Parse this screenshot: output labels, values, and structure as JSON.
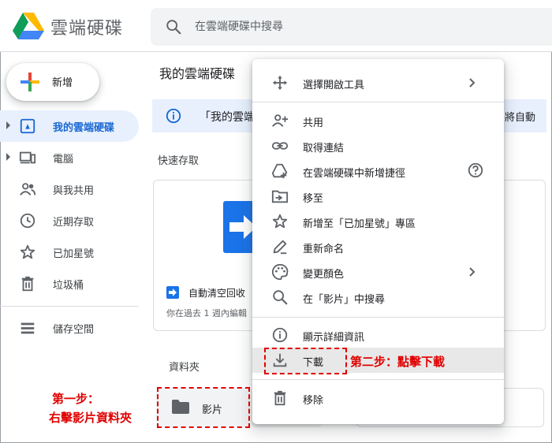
{
  "app": {
    "title": "雲端硬碟",
    "search_placeholder": "在雲端硬碟中搜尋"
  },
  "sidebar": {
    "new_label": "新增",
    "items": [
      {
        "label": "我的雲端硬碟",
        "icon": "my-drive-icon",
        "active": true
      },
      {
        "label": "電腦",
        "icon": "computers-icon"
      },
      {
        "label": "與我共用",
        "icon": "shared-icon"
      },
      {
        "label": "近期存取",
        "icon": "clock-icon"
      },
      {
        "label": "已加星號",
        "icon": "star-icon"
      },
      {
        "label": "垃圾桶",
        "icon": "trash-icon"
      }
    ],
    "storage_label": "儲存空間"
  },
  "main": {
    "title": "我的雲端硬碟",
    "banner_text": "「我的雲端",
    "banner_right": "將自動",
    "quick_access_label": "快速存取",
    "card_name": "自動清空回收",
    "card_sub": "你在過去 1 週內編輯",
    "folders_label": "資料夾",
    "folder_name": "影片"
  },
  "menu": {
    "items": [
      {
        "label": "選擇開啟工具",
        "icon": "open-with-icon",
        "submenu": true
      },
      {
        "label": "共用",
        "icon": "share-icon"
      },
      {
        "label": "取得連結",
        "icon": "link-icon"
      },
      {
        "label": "在雲端硬碟中新增捷徑",
        "icon": "add-shortcut-icon",
        "help": true
      },
      {
        "label": "移至",
        "icon": "move-icon"
      },
      {
        "label": "新增至「已加星號」專區",
        "icon": "star-icon"
      },
      {
        "label": "重新命名",
        "icon": "rename-icon"
      },
      {
        "label": "變更顏色",
        "icon": "palette-icon",
        "submenu": true
      },
      {
        "label": "在「影片」中搜尋",
        "icon": "search-icon"
      },
      {
        "label": "顯示詳細資訊",
        "icon": "info-icon"
      },
      {
        "label": "下載",
        "icon": "download-icon",
        "highlighted": true
      },
      {
        "label": "移除",
        "icon": "trash-icon"
      }
    ]
  },
  "annotations": {
    "step1_line1": "第一步：",
    "step1_line2": "右擊影片資料夾",
    "step2": "第二步：點擊下載"
  },
  "colors": {
    "accent": "#1a73e8",
    "annotation": "#e00000",
    "active_bg": "#e8f0fe"
  }
}
